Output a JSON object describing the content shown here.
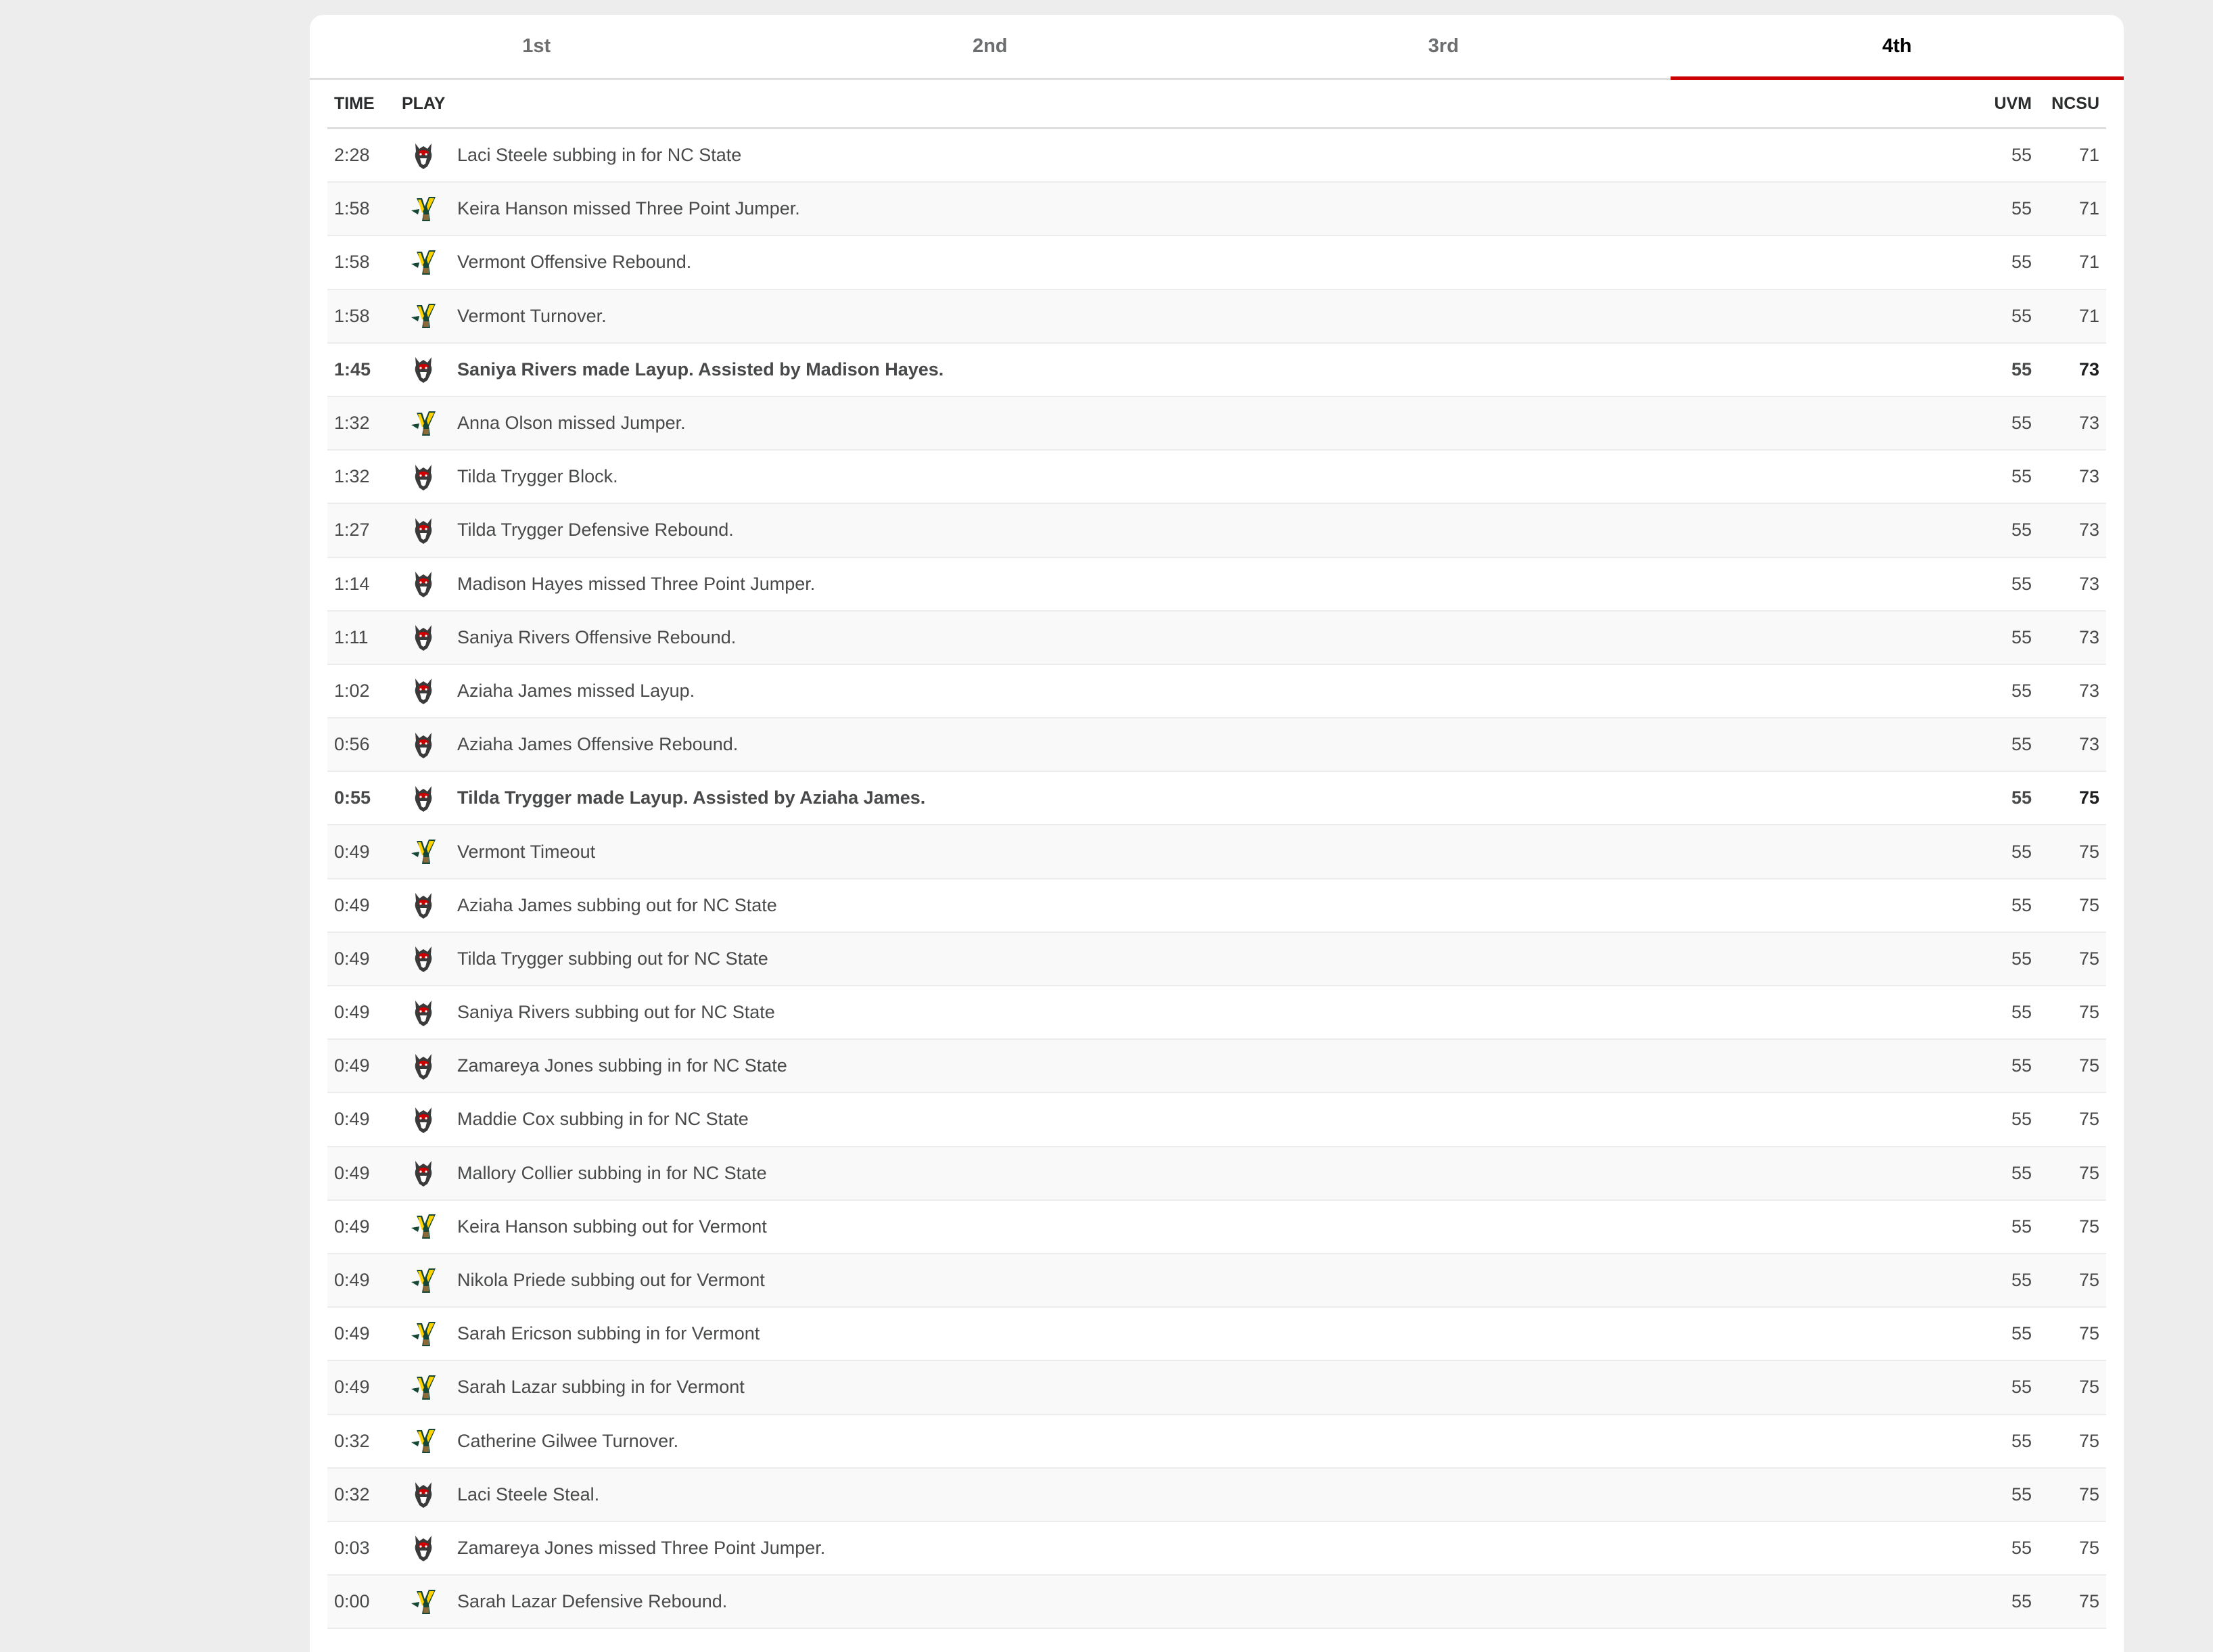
{
  "tabs": [
    {
      "label": "1st",
      "active": false
    },
    {
      "label": "2nd",
      "active": false
    },
    {
      "label": "3rd",
      "active": false
    },
    {
      "label": "4th",
      "active": true
    }
  ],
  "headers": {
    "time": "TIME",
    "play": "PLAY",
    "away": "UVM",
    "home": "NCSU"
  },
  "colors": {
    "accent": "#cc0000",
    "background": "#ededee",
    "row_alt": "#f9f9f9"
  },
  "team_icons": {
    "NCSU": "wolfpack-logo-icon",
    "UVM": "catamounts-logo-icon"
  },
  "plays": [
    {
      "time": "2:28",
      "team": "NCSU",
      "text": "Laci Steele subbing in for NC State",
      "uvm": "55",
      "ncsu": "71",
      "scoring": false
    },
    {
      "time": "1:58",
      "team": "UVM",
      "text": "Keira Hanson missed Three Point Jumper.",
      "uvm": "55",
      "ncsu": "71",
      "scoring": false
    },
    {
      "time": "1:58",
      "team": "UVM",
      "text": "Vermont Offensive Rebound.",
      "uvm": "55",
      "ncsu": "71",
      "scoring": false
    },
    {
      "time": "1:58",
      "team": "UVM",
      "text": "Vermont Turnover.",
      "uvm": "55",
      "ncsu": "71",
      "scoring": false
    },
    {
      "time": "1:45",
      "team": "NCSU",
      "text": "Saniya Rivers made Layup. Assisted by Madison Hayes.",
      "uvm": "55",
      "ncsu": "73",
      "scoring": true
    },
    {
      "time": "1:32",
      "team": "UVM",
      "text": "Anna Olson missed Jumper.",
      "uvm": "55",
      "ncsu": "73",
      "scoring": false
    },
    {
      "time": "1:32",
      "team": "NCSU",
      "text": "Tilda Trygger Block.",
      "uvm": "55",
      "ncsu": "73",
      "scoring": false
    },
    {
      "time": "1:27",
      "team": "NCSU",
      "text": "Tilda Trygger Defensive Rebound.",
      "uvm": "55",
      "ncsu": "73",
      "scoring": false
    },
    {
      "time": "1:14",
      "team": "NCSU",
      "text": "Madison Hayes missed Three Point Jumper.",
      "uvm": "55",
      "ncsu": "73",
      "scoring": false
    },
    {
      "time": "1:11",
      "team": "NCSU",
      "text": "Saniya Rivers Offensive Rebound.",
      "uvm": "55",
      "ncsu": "73",
      "scoring": false
    },
    {
      "time": "1:02",
      "team": "NCSU",
      "text": "Aziaha James missed Layup.",
      "uvm": "55",
      "ncsu": "73",
      "scoring": false
    },
    {
      "time": "0:56",
      "team": "NCSU",
      "text": "Aziaha James Offensive Rebound.",
      "uvm": "55",
      "ncsu": "73",
      "scoring": false
    },
    {
      "time": "0:55",
      "team": "NCSU",
      "text": "Tilda Trygger made Layup. Assisted by Aziaha James.",
      "uvm": "55",
      "ncsu": "75",
      "scoring": true
    },
    {
      "time": "0:49",
      "team": "UVM",
      "text": "Vermont Timeout",
      "uvm": "55",
      "ncsu": "75",
      "scoring": false
    },
    {
      "time": "0:49",
      "team": "NCSU",
      "text": "Aziaha James subbing out for NC State",
      "uvm": "55",
      "ncsu": "75",
      "scoring": false
    },
    {
      "time": "0:49",
      "team": "NCSU",
      "text": "Tilda Trygger subbing out for NC State",
      "uvm": "55",
      "ncsu": "75",
      "scoring": false
    },
    {
      "time": "0:49",
      "team": "NCSU",
      "text": "Saniya Rivers subbing out for NC State",
      "uvm": "55",
      "ncsu": "75",
      "scoring": false
    },
    {
      "time": "0:49",
      "team": "NCSU",
      "text": "Zamareya Jones subbing in for NC State",
      "uvm": "55",
      "ncsu": "75",
      "scoring": false
    },
    {
      "time": "0:49",
      "team": "NCSU",
      "text": "Maddie Cox subbing in for NC State",
      "uvm": "55",
      "ncsu": "75",
      "scoring": false
    },
    {
      "time": "0:49",
      "team": "NCSU",
      "text": "Mallory Collier subbing in for NC State",
      "uvm": "55",
      "ncsu": "75",
      "scoring": false
    },
    {
      "time": "0:49",
      "team": "UVM",
      "text": "Keira Hanson subbing out for Vermont",
      "uvm": "55",
      "ncsu": "75",
      "scoring": false
    },
    {
      "time": "0:49",
      "team": "UVM",
      "text": "Nikola Priede subbing out for Vermont",
      "uvm": "55",
      "ncsu": "75",
      "scoring": false
    },
    {
      "time": "0:49",
      "team": "UVM",
      "text": "Sarah Ericson subbing in for Vermont",
      "uvm": "55",
      "ncsu": "75",
      "scoring": false
    },
    {
      "time": "0:49",
      "team": "UVM",
      "text": "Sarah Lazar subbing in for Vermont",
      "uvm": "55",
      "ncsu": "75",
      "scoring": false
    },
    {
      "time": "0:32",
      "team": "UVM",
      "text": "Catherine Gilwee Turnover.",
      "uvm": "55",
      "ncsu": "75",
      "scoring": false
    },
    {
      "time": "0:32",
      "team": "NCSU",
      "text": "Laci Steele Steal.",
      "uvm": "55",
      "ncsu": "75",
      "scoring": false
    },
    {
      "time": "0:03",
      "team": "NCSU",
      "text": "Zamareya Jones missed Three Point Jumper.",
      "uvm": "55",
      "ncsu": "75",
      "scoring": false
    },
    {
      "time": "0:00",
      "team": "UVM",
      "text": "Sarah Lazar Defensive Rebound.",
      "uvm": "55",
      "ncsu": "75",
      "scoring": false
    }
  ]
}
